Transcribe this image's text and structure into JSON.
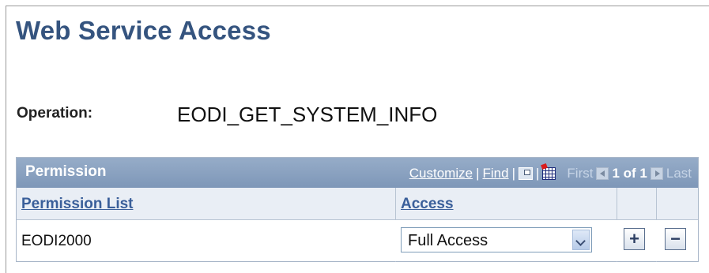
{
  "page": {
    "title": "Web Service Access"
  },
  "operation": {
    "label": "Operation:",
    "value": "EODI_GET_SYSTEM_INFO"
  },
  "grid": {
    "title": "Permission",
    "nav": {
      "customize": "Customize",
      "find": "Find",
      "separator": "|",
      "first": "First",
      "count": "1 of 1",
      "last": "Last"
    },
    "columns": {
      "permission_list": "Permission List",
      "access": "Access"
    },
    "rows": [
      {
        "permission_list": "EODI2000",
        "access": "Full Access"
      }
    ],
    "add_symbol": "+",
    "delete_symbol": "−"
  },
  "colors": {
    "title": "#35547f",
    "grid_header": "#8aa2c2",
    "column_link": "#3a5f9a"
  },
  "icons": [
    "view-all-icon",
    "download-grid-icon",
    "previous-arrow-icon",
    "next-arrow-icon",
    "dropdown-arrow-icon",
    "add-row-icon",
    "delete-row-icon"
  ]
}
